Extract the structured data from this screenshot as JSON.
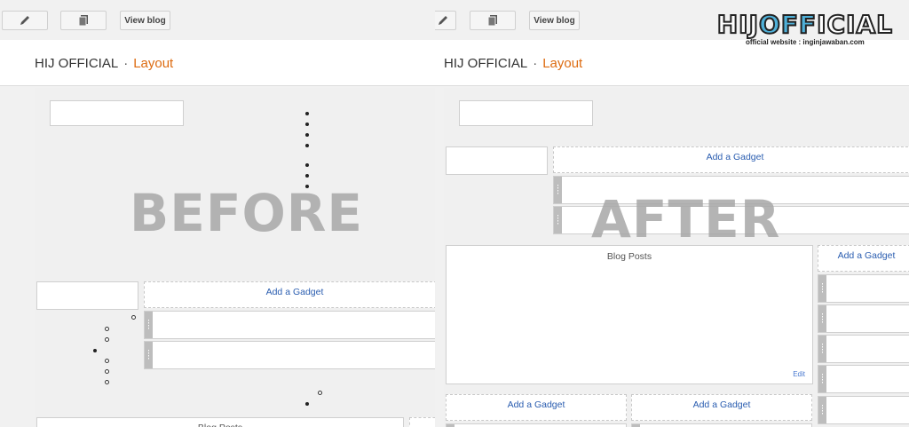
{
  "blog_name": "HIJ OFFICIAL",
  "separator": "·",
  "page_section": "Layout",
  "toolbar": {
    "view_blog": "View blog"
  },
  "before_label": "BEFORE",
  "after_label": "AFTER",
  "add_gadget": "Add a Gadget",
  "blog_posts": "Blog Posts",
  "edit": "Edit",
  "watermark": {
    "brand_pre": "HIJ",
    "brand_mid": "OFF",
    "brand_post": "ICIAL",
    "subtitle": "official website : inginjawaban.com"
  },
  "icons": [
    "pencil-icon",
    "pages-icon",
    "drag-handle-icon"
  ]
}
